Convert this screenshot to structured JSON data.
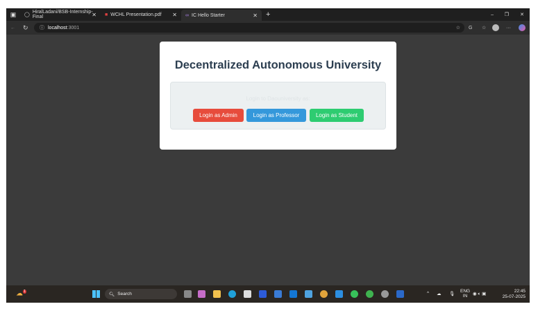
{
  "browser": {
    "tabs": [
      {
        "label": "HiralLadani/BSB-Internship-Final",
        "icon": "github-icon"
      },
      {
        "label": "WCHL Presentation.pdf",
        "icon": "pdf-icon"
      },
      {
        "label": "IC Hello Starter",
        "icon": "infinity-icon",
        "active": true
      }
    ],
    "url_host": "localhost",
    "url_port": ":3001"
  },
  "page": {
    "title": "Decentralized Autonomous University",
    "prompt": "Login to Daouniversity as:",
    "buttons": [
      {
        "label": "Login as Admin",
        "color": "#e74c3c"
      },
      {
        "label": "Login as Professor",
        "color": "#3498db"
      },
      {
        "label": "Login as Student",
        "color": "#2ecc71"
      }
    ]
  },
  "taskbar": {
    "search_label": "Search",
    "lang": "ENG",
    "region": "IN",
    "time": "22:45",
    "date": "25-07-2025",
    "weather_badge": "1"
  }
}
